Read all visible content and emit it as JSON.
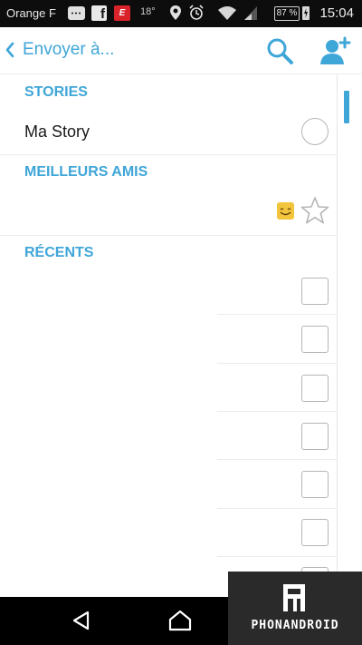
{
  "status_bar": {
    "carrier": "Orange F",
    "temperature": "18°",
    "battery": "87 %",
    "time": "15:04",
    "icons": [
      "chat-icon",
      "facebook-icon",
      "news-app-icon",
      "location-icon",
      "alarm-icon",
      "wifi-icon",
      "signal-icon",
      "battery-icon"
    ]
  },
  "header": {
    "title": "Envoyer à...",
    "back_icon": "chevron-left-icon",
    "search_icon": "search-icon",
    "add_friend_icon": "add-friend-icon"
  },
  "sections": {
    "stories": {
      "label": "STORIES",
      "items": [
        {
          "label": "Ma Story",
          "selected": false
        }
      ]
    },
    "best_friends": {
      "label": "MEILLEURS AMIS",
      "items": [
        {
          "label": "",
          "emoji": "smiling-emoji",
          "starred": false
        }
      ]
    },
    "recents": {
      "label": "RÉCENTS",
      "items": [
        {
          "label": "",
          "checked": false
        },
        {
          "label": "",
          "checked": false
        },
        {
          "label": "",
          "checked": false
        },
        {
          "label": "",
          "checked": false
        },
        {
          "label": "",
          "checked": false
        },
        {
          "label": "",
          "checked": false
        },
        {
          "label": "",
          "checked": false
        }
      ]
    }
  },
  "nav_bar": {
    "icons": [
      "back-triangle-icon",
      "home-icon"
    ]
  },
  "watermark": {
    "text": "PHONANDROID"
  },
  "colors": {
    "accent": "#3fa6d8",
    "status_bar_bg": "#0d0d0d",
    "nav_bar_bg": "#000000"
  }
}
